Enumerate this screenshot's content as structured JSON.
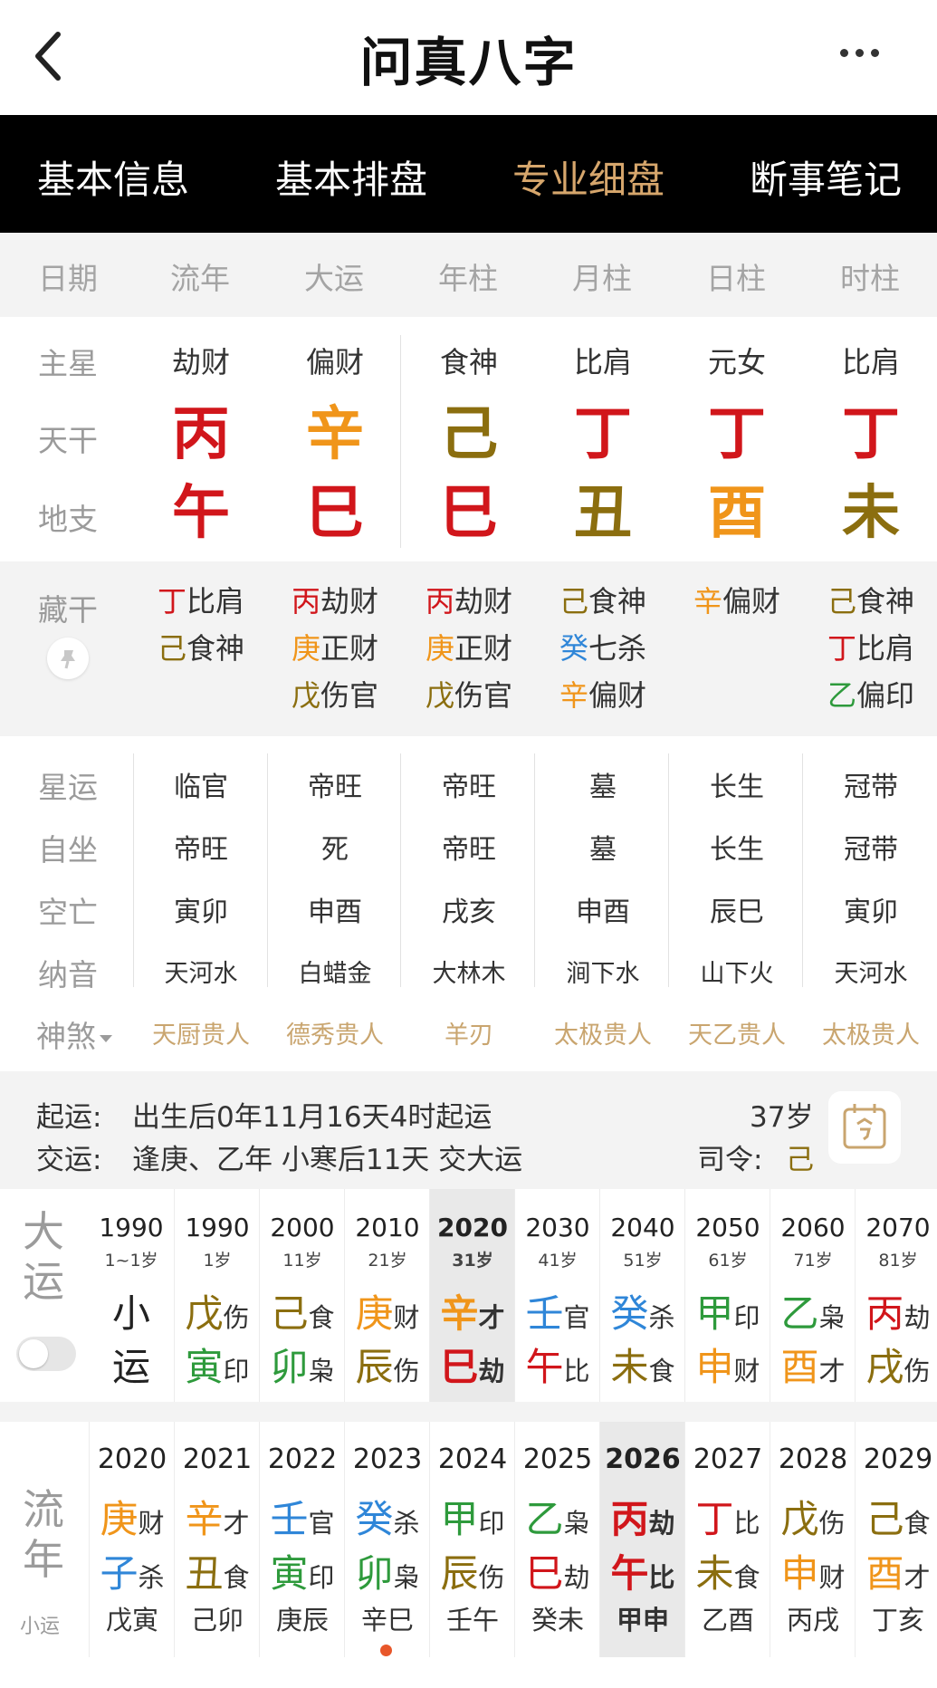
{
  "header": {
    "title": "问真八字",
    "back_icon": "chevron-left-icon",
    "more_icon": "more-dots-icon"
  },
  "tabs": [
    "基本信息",
    "基本排盘",
    "专业细盘",
    "断事笔记"
  ],
  "active_tab": "专业细盘",
  "colors": {
    "red": "#d1161b",
    "orange": "#f0951a",
    "olive": "#8b6e0f",
    "blue": "#2f86d8",
    "green": "#2e9a3c",
    "accent": "#d6a66c",
    "gold_text": "#c9a56f"
  },
  "columns": [
    "日期",
    "流年",
    "大运",
    "年柱",
    "月柱",
    "日柱",
    "时柱"
  ],
  "rows": {
    "zhuxing": {
      "label": "主星",
      "values": [
        "劫财",
        "偏财",
        "食神",
        "比肩",
        "元女",
        "比肩"
      ]
    },
    "tiangan": {
      "label": "天干",
      "values": [
        "丙",
        "辛",
        "己",
        "丁",
        "丁",
        "丁"
      ]
    },
    "dizhi": {
      "label": "地支",
      "values": [
        "午",
        "巳",
        "巳",
        "丑",
        "酉",
        "未"
      ]
    }
  },
  "canggan": {
    "label": "藏干",
    "pin_icon": "pin-icon",
    "cols": [
      [
        [
          "丁",
          "比肩"
        ],
        [
          "己",
          "食神"
        ]
      ],
      [
        [
          "丙",
          "劫财"
        ],
        [
          "庚",
          "正财"
        ],
        [
          "戊",
          "伤官"
        ]
      ],
      [
        [
          "丙",
          "劫财"
        ],
        [
          "庚",
          "正财"
        ],
        [
          "戊",
          "伤官"
        ]
      ],
      [
        [
          "己",
          "食神"
        ],
        [
          "癸",
          "七杀"
        ],
        [
          "辛",
          "偏财"
        ]
      ],
      [
        [
          "辛",
          "偏财"
        ]
      ],
      [
        [
          "己",
          "食神"
        ],
        [
          "丁",
          "比肩"
        ],
        [
          "乙",
          "偏印"
        ]
      ]
    ]
  },
  "info_rows": {
    "xingyun": {
      "label": "星运",
      "values": [
        "临官",
        "帝旺",
        "帝旺",
        "墓",
        "长生",
        "冠带"
      ]
    },
    "zizuo": {
      "label": "自坐",
      "values": [
        "帝旺",
        "死",
        "帝旺",
        "墓",
        "长生",
        "冠带"
      ]
    },
    "kongwang": {
      "label": "空亡",
      "values": [
        "寅卯",
        "申酉",
        "戌亥",
        "申酉",
        "辰巳",
        "寅卯"
      ]
    },
    "nayin": {
      "label": "纳音",
      "values": [
        "天河水",
        "白蜡金",
        "大林木",
        "涧下水",
        "山下火",
        "天河水"
      ]
    },
    "shensha": {
      "label": "神煞",
      "values": [
        "天厨贵人",
        "德秀贵人",
        "羊刃",
        "太极贵人",
        "天乙贵人",
        "太极贵人"
      ]
    }
  },
  "qiyun": {
    "qiyun_label": "起运:",
    "qiyun_text": "出生后0年11月16天4时起运",
    "jiaoyun_label": "交运:",
    "jiaoyun_text": "逢庚、乙年 小寒后11天 交大运",
    "age": "37岁",
    "siling_label": "司令:",
    "siling_value": "己",
    "calendar_icon": "calendar-icon"
  },
  "dayun": {
    "label": "大运",
    "toggle": "off",
    "items": [
      {
        "year": "1990",
        "age": "1~1岁",
        "g": "小",
        "gs": "",
        "z": "运",
        "zs": ""
      },
      {
        "year": "1990",
        "age": "1岁",
        "g": "戊",
        "gs": "伤",
        "z": "寅",
        "zs": "印"
      },
      {
        "year": "2000",
        "age": "11岁",
        "g": "己",
        "gs": "食",
        "z": "卯",
        "zs": "枭"
      },
      {
        "year": "2010",
        "age": "21岁",
        "g": "庚",
        "gs": "财",
        "z": "辰",
        "zs": "伤"
      },
      {
        "year": "2020",
        "age": "31岁",
        "g": "辛",
        "gs": "才",
        "z": "巳",
        "zs": "劫"
      },
      {
        "year": "2030",
        "age": "41岁",
        "g": "壬",
        "gs": "官",
        "z": "午",
        "zs": "比"
      },
      {
        "year": "2040",
        "age": "51岁",
        "g": "癸",
        "gs": "杀",
        "z": "未",
        "zs": "食"
      },
      {
        "year": "2050",
        "age": "61岁",
        "g": "甲",
        "gs": "印",
        "z": "申",
        "zs": "财"
      },
      {
        "year": "2060",
        "age": "71岁",
        "g": "乙",
        "gs": "枭",
        "z": "酉",
        "zs": "才"
      },
      {
        "year": "2070",
        "age": "81岁",
        "g": "丙",
        "gs": "劫",
        "z": "戌",
        "zs": "伤"
      }
    ]
  },
  "liunian": {
    "label": "流年",
    "sub_label": "小运",
    "items": [
      {
        "year": "2020",
        "g": "庚",
        "gs": "财",
        "z": "子",
        "zs": "杀",
        "xy": "戊寅"
      },
      {
        "year": "2021",
        "g": "辛",
        "gs": "才",
        "z": "丑",
        "zs": "食",
        "xy": "己卯"
      },
      {
        "year": "2022",
        "g": "壬",
        "gs": "官",
        "z": "寅",
        "zs": "印",
        "xy": "庚辰"
      },
      {
        "year": "2023",
        "g": "癸",
        "gs": "杀",
        "z": "卯",
        "zs": "枭",
        "xy": "辛巳"
      },
      {
        "year": "2024",
        "g": "甲",
        "gs": "印",
        "z": "辰",
        "zs": "伤",
        "xy": "壬午"
      },
      {
        "year": "2025",
        "g": "乙",
        "gs": "枭",
        "z": "巳",
        "zs": "劫",
        "xy": "癸未"
      },
      {
        "year": "2026",
        "g": "丙",
        "gs": "劫",
        "z": "午",
        "zs": "比",
        "xy": "甲申"
      },
      {
        "year": "2027",
        "g": "丁",
        "gs": "比",
        "z": "未",
        "zs": "食",
        "xy": "乙酉"
      },
      {
        "year": "2028",
        "g": "戊",
        "gs": "伤",
        "z": "申",
        "zs": "财",
        "xy": "丙戌"
      },
      {
        "year": "2029",
        "g": "己",
        "gs": "食",
        "z": "酉",
        "zs": "才",
        "xy": "丁亥"
      }
    ]
  }
}
